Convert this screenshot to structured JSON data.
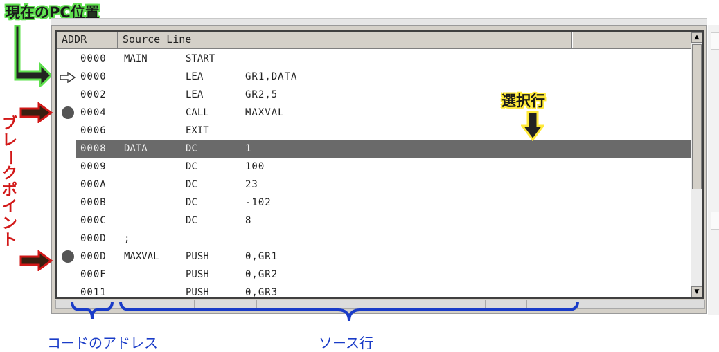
{
  "annotations": {
    "pc_label": "現在のPC位置",
    "selected_label": "選択行",
    "breakpoint_label_chars": [
      "ブ",
      "レ",
      "ー",
      "ク",
      "ポ",
      "イ",
      "ン",
      "ト"
    ],
    "addr_label": "コードのアドレス",
    "source_label": "ソース行",
    "colors": {
      "pc": "#5ee04e",
      "selected": "#ffea3a",
      "breakpoint": "#d21818",
      "blue": "#1a3cc8"
    }
  },
  "listing": {
    "headers": {
      "addr": "ADDR",
      "source": "Source Line"
    },
    "rows": [
      {
        "addr": "0000",
        "label": "MAIN",
        "op": "START",
        "arg": "",
        "marker": "none"
      },
      {
        "addr": "0000",
        "label": "",
        "op": "LEA",
        "arg": "GR1,DATA",
        "marker": "pc"
      },
      {
        "addr": "0002",
        "label": "",
        "op": "LEA",
        "arg": "GR2,5",
        "marker": "none"
      },
      {
        "addr": "0004",
        "label": "",
        "op": "CALL",
        "arg": "MAXVAL",
        "marker": "breakpoint"
      },
      {
        "addr": "0006",
        "label": "",
        "op": "EXIT",
        "arg": "",
        "marker": "none"
      },
      {
        "addr": "0008",
        "label": "DATA",
        "op": "DC",
        "arg": "1",
        "marker": "selected"
      },
      {
        "addr": "0009",
        "label": "",
        "op": "DC",
        "arg": "100",
        "marker": "none"
      },
      {
        "addr": "000A",
        "label": "",
        "op": "DC",
        "arg": "23",
        "marker": "none"
      },
      {
        "addr": "000B",
        "label": "",
        "op": "DC",
        "arg": "-102",
        "marker": "none"
      },
      {
        "addr": "000C",
        "label": "",
        "op": "DC",
        "arg": "8",
        "marker": "none"
      },
      {
        "addr": "000D",
        "label": ";",
        "op": "",
        "arg": "",
        "marker": "none"
      },
      {
        "addr": "000D",
        "label": "MAXVAL",
        "op": "PUSH",
        "arg": "0,GR1",
        "marker": "breakpoint"
      },
      {
        "addr": "000F",
        "label": "",
        "op": "PUSH",
        "arg": "0,GR2",
        "marker": "none"
      },
      {
        "addr": "0011",
        "label": "",
        "op": "PUSH",
        "arg": "0,GR3",
        "marker": "none"
      }
    ]
  },
  "scrollbar": {
    "up_icon": "scroll-up-arrow",
    "down_icon": "scroll-down-arrow"
  }
}
